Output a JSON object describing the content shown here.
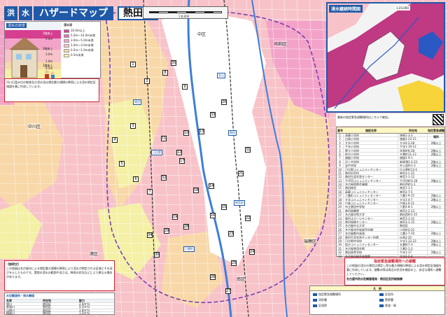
{
  "header": {
    "badge": "洪",
    "badge2": "水",
    "title": "ハザードマップ",
    "ward": "熱田区"
  },
  "scalebar": {
    "label": "1:8,000"
  },
  "legend": {
    "title": "浸水の目安",
    "depth_title": "浸水深",
    "depths": [
      {
        "label": "10.0m以上",
        "color": "#d63f8f"
      },
      {
        "label": "5.0m～10.0m未満",
        "color": "#e86bb0"
      },
      {
        "label": "3.0m～5.0m未満",
        "color": "#f3a3c8"
      },
      {
        "label": "1.0m～3.0m未満",
        "color": "#f7c3c9"
      },
      {
        "label": "0.5m～1.0m未満",
        "color": "#f8d8a8"
      },
      {
        "label": "0.5m未満",
        "color": "#f4f0a6"
      }
    ],
    "floor_labels": [
      "5.0m",
      "3.0m",
      "1.0m",
      "0.5m"
    ],
    "floor_text": [
      "3階床上",
      "2階床上",
      "1階床上"
    ]
  },
  "wards": {
    "naka": "中区",
    "showa": "昭和区",
    "nakagawa": "中川区",
    "minato": "港区",
    "minami": "南区",
    "mizuho": "瑞穂区"
  },
  "stations": [
    "金山",
    "熱田",
    "神宮前",
    "堀田",
    "日比野",
    "六番町"
  ],
  "map_numbers": [
    "1",
    "2",
    "3",
    "4",
    "5",
    "6",
    "7",
    "8",
    "9",
    "10",
    "11",
    "12",
    "13",
    "14",
    "15",
    "16",
    "17",
    "18",
    "19",
    "20",
    "21",
    "22",
    "23",
    "24",
    "25",
    "26",
    "27",
    "28",
    "29",
    "30",
    "31",
    "32",
    "33",
    "34",
    "35"
  ],
  "inset": {
    "title": "浸水継続時間図",
    "scale": "1:25,000"
  },
  "qr_text": "最新の指定緊急避難場所はこちらで確認。",
  "shelter_table": {
    "col_no": "番号",
    "col_name": "施設名称",
    "col_addr": "所在地",
    "col_type": "指定緊急避難場所",
    "rows": [
      {
        "no": "1",
        "name": "高蔵小学校",
        "addr": "旗屋1-3-3",
        "type": ""
      },
      {
        "no": "2",
        "name": "白鳥小学校",
        "addr": "旗屋2-23-15",
        "type": ""
      },
      {
        "no": "3",
        "name": "大宝小学校",
        "addr": "大宝4-2-28",
        "type": "2階以上"
      },
      {
        "no": "4",
        "name": "千年小学校",
        "addr": "千年1-19-12",
        "type": ""
      },
      {
        "no": "5",
        "name": "野立小学校",
        "addr": "花表町6-28",
        "type": "2階以上"
      },
      {
        "no": "6",
        "name": "船方小学校",
        "addr": "五番町11-13",
        "type": "2階以上"
      },
      {
        "no": "7",
        "name": "旗屋小学校",
        "addr": "旗屋2-9-1",
        "type": ""
      },
      {
        "no": "8",
        "name": "沢上中学校",
        "addr": "新尾頭3-3-33",
        "type": "2階以上"
      },
      {
        "no": "9",
        "name": "宝中学校",
        "addr": "外土居町1-3",
        "type": "2階以上"
      },
      {
        "no": "10",
        "name": "日比野コミュニティセンター",
        "addr": "比々野町13-1",
        "type": ""
      },
      {
        "no": "11",
        "name": "熱田区役所",
        "addr": "神宮3-1-15",
        "type": ""
      },
      {
        "no": "12",
        "name": "熱田生涯学習センター",
        "addr": "神宮1-1-12",
        "type": ""
      },
      {
        "no": "13",
        "name": "千代田コミュニティセンター",
        "addr": "千代田町3-18",
        "type": "2階以上"
      },
      {
        "no": "14",
        "name": "名古屋国際会議場",
        "addr": "熱田西町1-1",
        "type": ""
      },
      {
        "no": "15",
        "name": "熱田神宮",
        "addr": "神宮1-1-1",
        "type": ""
      },
      {
        "no": "16",
        "name": "高蔵コミュニティセンター",
        "addr": "神宮2-7-5",
        "type": ""
      },
      {
        "no": "17",
        "name": "六番町コミュニティセンター",
        "addr": "六番1-9-15",
        "type": "2階以上"
      },
      {
        "no": "18",
        "name": "大宝コミュニティセンター",
        "addr": "大宝1-4-7",
        "type": "2階以上"
      },
      {
        "no": "19",
        "name": "白鳥コミュニティセンター",
        "addr": "白鳥1-9-11",
        "type": ""
      },
      {
        "no": "20",
        "name": "市立熱田中学校",
        "addr": "六野2-8-1",
        "type": "2階以上"
      },
      {
        "no": "21",
        "name": "熱田図書館",
        "addr": "神宮2-2-13",
        "type": ""
      },
      {
        "no": "22",
        "name": "名古屋学院大学",
        "addr": "熱田西町1-25",
        "type": ""
      },
      {
        "no": "23",
        "name": "熱田スポーツセンター",
        "addr": "神宮3-1-15",
        "type": ""
      },
      {
        "no": "24",
        "name": "熱田保健センター",
        "addr": "神宮3-1-15",
        "type": "2階以上"
      },
      {
        "no": "25",
        "name": "名古屋市立大学",
        "addr": "熱田区",
        "type": ""
      },
      {
        "no": "26",
        "name": "名古屋市中央卸売市場",
        "addr": "川並町2-22",
        "type": ""
      },
      {
        "no": "27",
        "name": "名古屋都市高速",
        "addr": "二番1-7-10",
        "type": "2階以上"
      },
      {
        "no": "28",
        "name": "熱田生涯学習センター別館",
        "addr": "伝馬2-25",
        "type": ""
      },
      {
        "no": "29",
        "name": "日比野中学校",
        "addr": "大宝1-12-23",
        "type": "2階以上"
      },
      {
        "no": "30",
        "name": "船方コミュニティセンター",
        "addr": "五番町7-3",
        "type": "2階以上"
      },
      {
        "no": "31",
        "name": "名古屋港湾会館",
        "addr": "六番2-1-3",
        "type": ""
      },
      {
        "no": "32",
        "name": "熱田高等学校",
        "addr": "千年1-17",
        "type": "2階以上"
      },
      {
        "no": "33",
        "name": "名古屋市総合体育館",
        "addr": "大宝3-2-4",
        "type": ""
      }
    ]
  },
  "conditions": {
    "title": "指定緊急避難場所への避難",
    "body": "この地図の浸水の想定は想定し得る最大規模の降雨による浸水想定区域図を基に作成しています。避難の際は周辺の状況を確認の上、安全な場所へ避難してください。",
    "contact": "名古屋市防災危機管理局・熱田区役所総務課"
  },
  "footer_legend": {
    "title": "凡　例",
    "items": [
      "指定緊急避難場所",
      "区役所",
      "消防署",
      "警察署",
      "区境界",
      "鉄道・駅"
    ]
  },
  "explain": {
    "title": "【説明文】",
    "body": "この地図は名古屋市による想定最大規模の降雨により浸水が想定される区域とその深さを示したものです。実際の浸水の範囲や深さは、降雨の状況などにより異なる場合があります。"
  },
  "pump_table": {
    "title": "水位観測所・排水機場",
    "headers": [
      "名称",
      "所在地",
      "能力"
    ],
    "rows": [
      [
        "堀川",
        "熱田区",
        "2.4m³/s"
      ],
      [
        "新堀川",
        "熱田区",
        "4.2m³/s"
      ],
      [
        "山崎川",
        "熱田区",
        "1.6m³/s"
      ],
      [
        "精進川",
        "熱田区",
        "1.2m³/s"
      ]
    ]
  },
  "note_small": "河川氾濫水位の推移及び浸水深は想定最大規模の降雨による浸水想定区域図を基に作成しています。"
}
